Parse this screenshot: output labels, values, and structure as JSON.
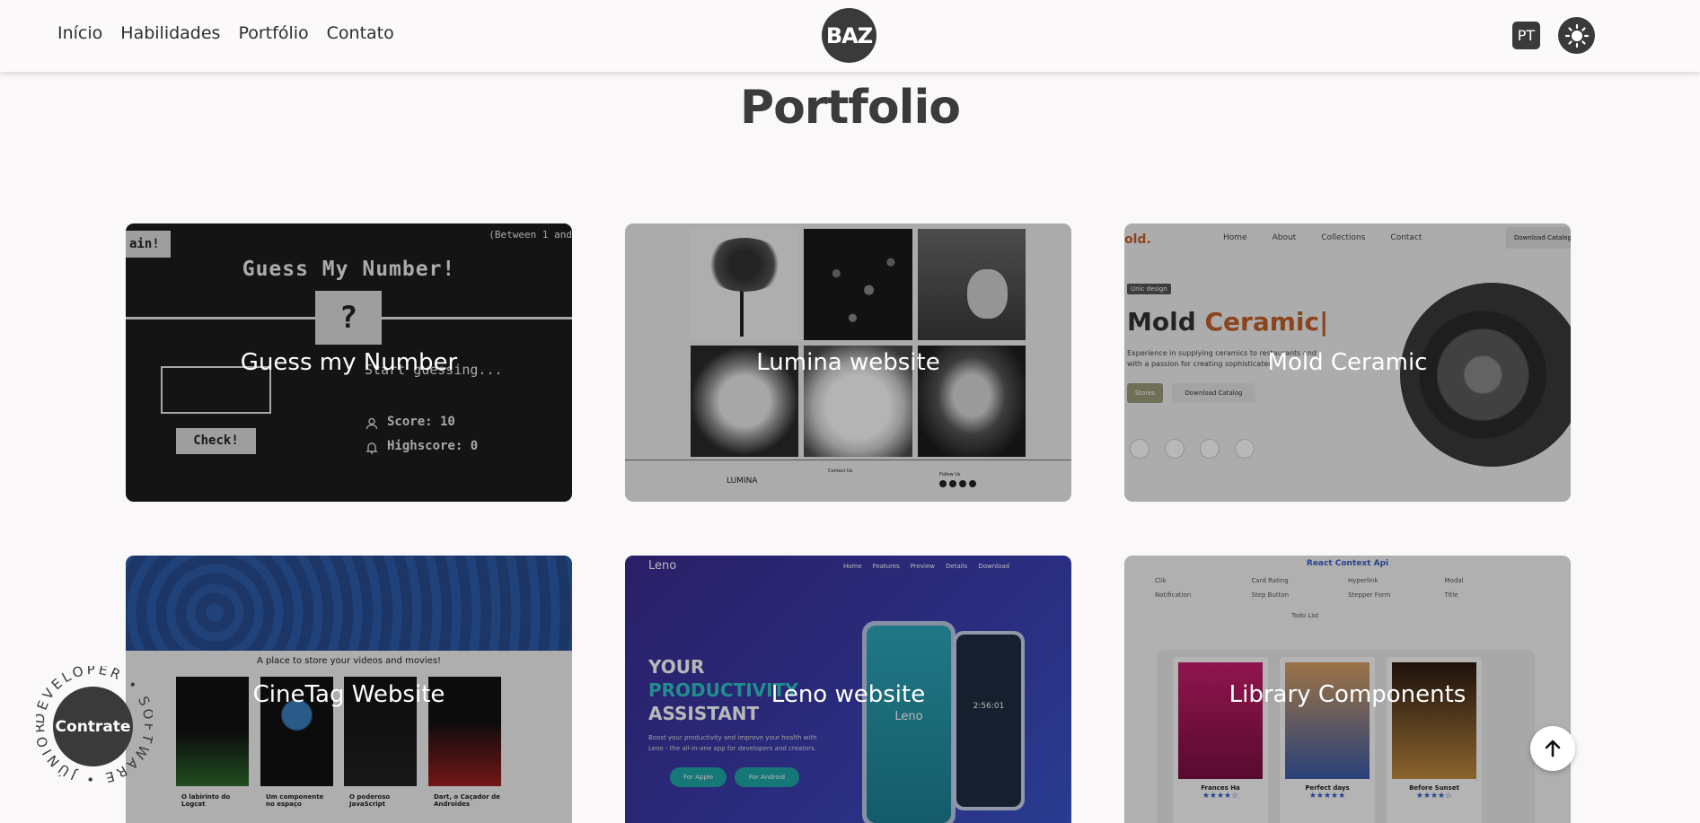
{
  "nav": {
    "items": [
      "Início",
      "Habilidades",
      "Portfólio",
      "Contato"
    ]
  },
  "logo": {
    "text": "BAZ"
  },
  "lang": {
    "label": "PT"
  },
  "theme": {
    "icon": "sun-icon"
  },
  "section": {
    "title": "Portfolio"
  },
  "projects": [
    {
      "title": "Guess my Number"
    },
    {
      "title": "Lumina website"
    },
    {
      "title": "Mold Ceramic"
    },
    {
      "title": "CineTag Website"
    },
    {
      "title": "Leno website"
    },
    {
      "title": "Library Components"
    }
  ],
  "thumb1": {
    "heading": "Guess My Number!",
    "between": "(Between 1 and",
    "again": "ain!",
    "mystery": "?",
    "status": "Start guessing...",
    "score": "Score: 10",
    "highscore": "Highscore: 0",
    "check": "Check!"
  },
  "thumb2": {
    "brand": "LUMINA",
    "contact": "Contact Us",
    "follow": "Follow Us"
  },
  "thumb3": {
    "brand": "old.",
    "menu": [
      "Home",
      "About",
      "Collections",
      "Contact"
    ],
    "cta": "Download Catalog",
    "tag": "Unic design",
    "head_a": "Mold ",
    "head_b": "Ceramic|",
    "desc1": "Experience in supplying ceramics to restaurants and",
    "desc2": "with a passion for creating sophisticated",
    "btn1": "Stores",
    "btn2": "Download Catalog"
  },
  "thumb4": {
    "tagline": "A place to store your videos and movies!",
    "captions": [
      "O labirinto do Logcat",
      "Um componente no espaço",
      "O poderoso JavaScript",
      "Dart, o Caçador de Androides"
    ]
  },
  "thumb5": {
    "brand": "Leno",
    "menu": [
      "Home",
      "Features",
      "Preview",
      "Details",
      "Download"
    ],
    "line1": "YOUR",
    "line2": "PRODUCTIVITY",
    "line3": "ASSISTANT",
    "desc1": "Boost your productivity and improve your health with",
    "desc2": "Leno - the all-in-one app for developers and creators.",
    "btn1": "For Apple",
    "btn2": "For Android",
    "phone_brand": "Leno",
    "timer": "2:56:01"
  },
  "thumb6": {
    "title": "React Context Api",
    "tools": [
      "Clik",
      "Card Rating",
      "Hyperlink",
      "Modal",
      "Notification",
      "Step Button",
      "Stepper Form",
      "Title",
      "Todo List"
    ],
    "books": [
      "Frances Ha",
      "Perfect days",
      "Before Sunset"
    ]
  },
  "hire": {
    "label": "Contrate",
    "ring": "DEVELOPER • SOFTWARE • JÚNIOR •"
  },
  "colors": {
    "accent_dark": "#3a3a3a",
    "background": "#faf8f9",
    "ceramic_orange": "#c0602a",
    "leno_teal": "#2ec4c4"
  }
}
